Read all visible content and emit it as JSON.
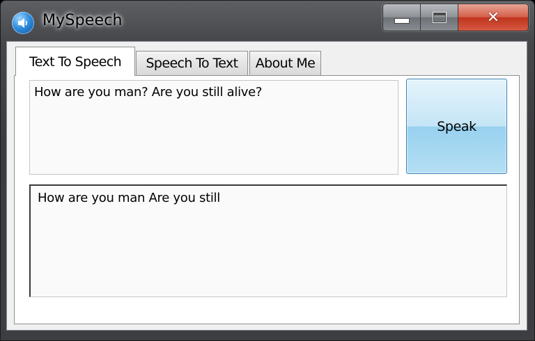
{
  "window": {
    "title": "MySpeech",
    "icon": "speaker-icon",
    "close_glyph": "✕"
  },
  "tabs": [
    {
      "label": "Text To Speech",
      "active": true
    },
    {
      "label": "Speech To Text",
      "active": false
    },
    {
      "label": "About Me",
      "active": false
    }
  ],
  "text_to_speech": {
    "input_value": "How are you man? Are you still alive?",
    "speak_label": "Speak",
    "output_value": "How are you man Are you still"
  },
  "colors": {
    "accent_button": "#b5dff4",
    "close_button": "#c0341d"
  }
}
